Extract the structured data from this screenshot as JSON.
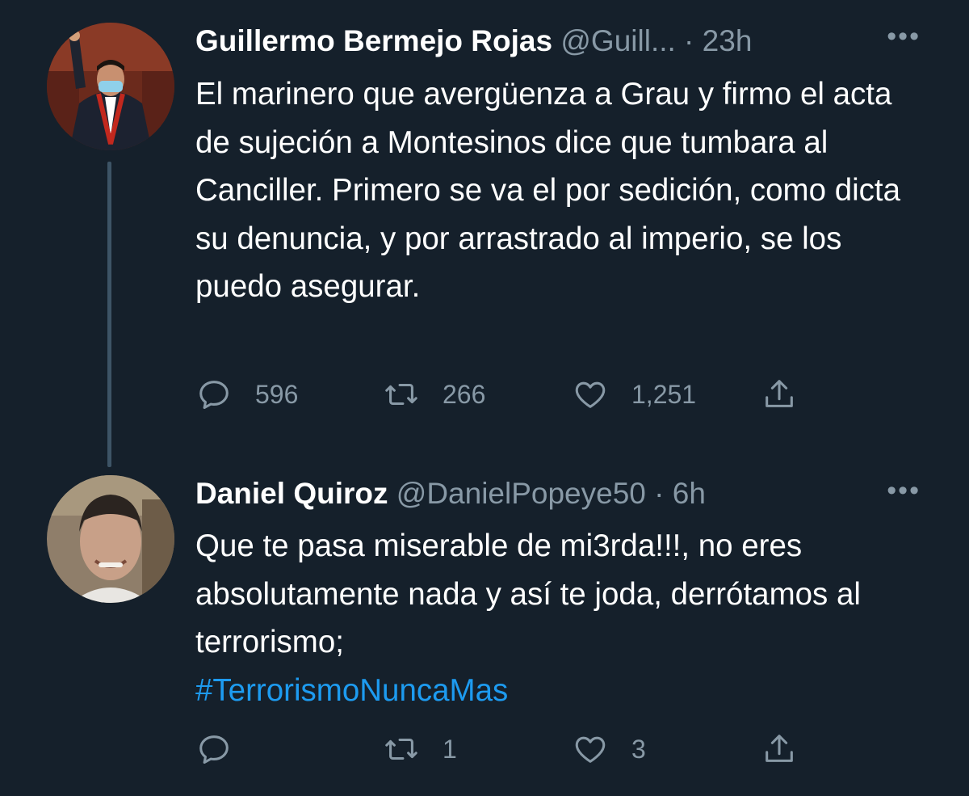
{
  "tweets": [
    {
      "author_name": "Guillermo Bermejo Rojas",
      "handle_time": "@Guill... · 23h",
      "more": "•••",
      "text": "El marinero que avergüenza a Grau y firmo el acta de sujeción a Montesinos dice que tumbara al Canciller. Primero se va el por sedición, como dicta su denuncia, y por arrastrado al imperio, se los puedo asegurar.",
      "hashtag": "",
      "replies": "596",
      "retweets": "266",
      "likes": "1,251"
    },
    {
      "author_name": "Daniel Quiroz",
      "handle_time": "@DanielPopeye50 · 6h",
      "more": "•••",
      "text": "Que te pasa miserable de mi3rda!!!, no eres absolutamente nada y así te joda, derrótamos al terrorismo;",
      "hashtag": "#TerrorismoNuncaMas",
      "replies": "",
      "retweets": "1",
      "likes": "3"
    }
  ],
  "colors": {
    "background": "#15202b",
    "text": "#ffffff",
    "secondary": "#8899a6",
    "link": "#1d9bf0",
    "thread_line": "#3d5466"
  },
  "icons": [
    "reply-icon",
    "retweet-icon",
    "like-icon",
    "share-icon",
    "more-icon"
  ]
}
